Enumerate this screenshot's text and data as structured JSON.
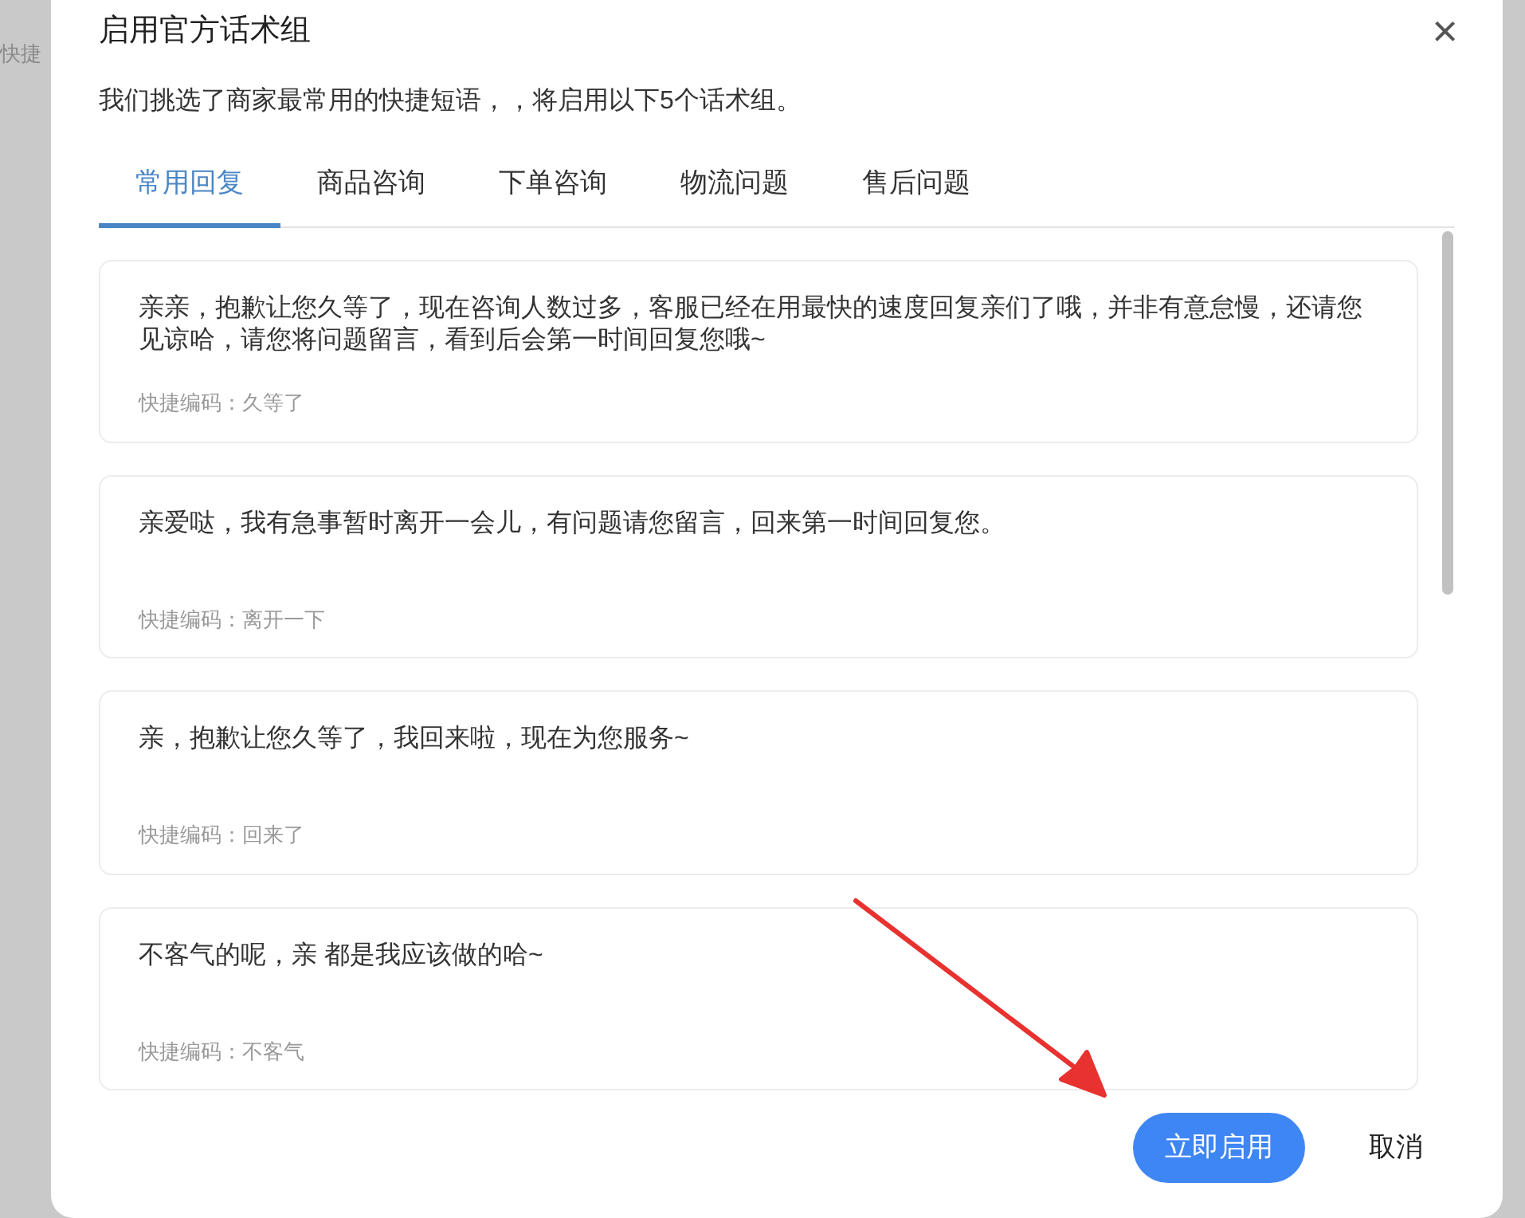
{
  "background": {
    "label": "快捷"
  },
  "dialog": {
    "title": "启用官方话术组",
    "close": "×",
    "description": "我们挑选了商家最常用的快捷短语，，将启用以下5个话术组。",
    "tabs": [
      {
        "label": "常用回复",
        "selected": true
      },
      {
        "label": "商品咨询",
        "selected": false
      },
      {
        "label": "下单咨询",
        "selected": false
      },
      {
        "label": "物流问题",
        "selected": false
      },
      {
        "label": "售后问题",
        "selected": false
      }
    ],
    "phrases": [
      {
        "text": "亲亲，抱歉让您久等了，现在咨询人数过多，客服已经在用最快的速度回复亲们了哦，并非有意怠慢，还请您见谅哈，请您将问题留言，看到后会第一时间回复您哦~",
        "code": "快捷编码：久等了"
      },
      {
        "text": "亲爱哒，我有急事暂时离开一会儿，有问题请您留言，回来第一时间回复您。",
        "code": "快捷编码：离开一下"
      },
      {
        "text": "亲，抱歉让您久等了，我回来啦，现在为您服务~",
        "code": "快捷编码：回来了"
      },
      {
        "text": "不客气的呢，亲 都是我应该做的哈~",
        "code": "快捷编码：不客气"
      }
    ],
    "buttons": [
      {
        "label": "立即启用",
        "kind": "primary"
      },
      {
        "label": "取消",
        "kind": "text"
      }
    ]
  }
}
